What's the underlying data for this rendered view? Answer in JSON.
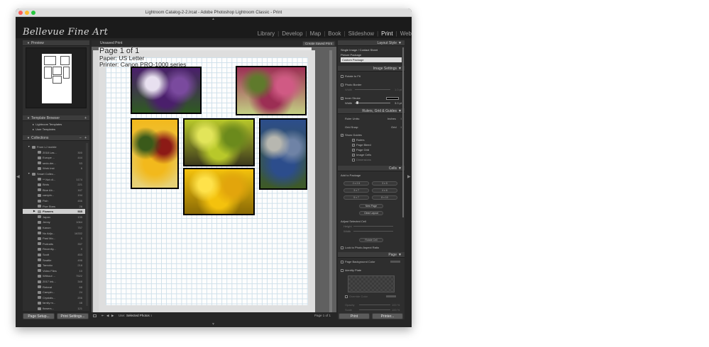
{
  "window": {
    "title": "Lightroom Catalog-2-2.lrcat - Adobe Photoshop Lightroom Classic - Print",
    "traffic_lights": {
      "close": "#fe5f57",
      "minimize": "#febc2e",
      "zoom": "#28c840"
    }
  },
  "app": {
    "brand": "Bellevue Fine Art",
    "modules": [
      "Library",
      "Develop",
      "Map",
      "Book",
      "Slideshow",
      "Print",
      "Web"
    ],
    "active_module": "Print"
  },
  "left_panel": {
    "preview": {
      "label": "Preview"
    },
    "template_browser": {
      "label": "Template Browser",
      "add": "+",
      "items": [
        "Lightroom Templates",
        "User Templates"
      ]
    },
    "collections": {
      "label": "Collections",
      "actions": [
        "−",
        "+"
      ]
    },
    "collection_rows": [
      {
        "name": "From LJ mobile",
        "count": "",
        "indent": 1,
        "tri": "▼"
      },
      {
        "name": "2018 Las...",
        "count": "300",
        "indent": 2
      },
      {
        "name": "Europe ...",
        "count": "444",
        "indent": 2
      },
      {
        "name": "sedo.dm...",
        "count": "53",
        "indent": 2
      },
      {
        "name": "Work inst",
        "count": "6",
        "indent": 2
      },
      {
        "name": "Smart Collec...",
        "count": "",
        "indent": 1,
        "tri": "▼"
      },
      {
        "name": "** Not di...",
        "count": "1174",
        "indent": 2
      },
      {
        "name": "Birds",
        "count": "221",
        "indent": 2
      },
      {
        "name": "Blue Ab...",
        "count": "167",
        "indent": 2
      },
      {
        "name": "campin...",
        "count": "194",
        "indent": 2
      },
      {
        "name": "Fish",
        "count": "456",
        "indent": 2
      },
      {
        "name": "Five Stars",
        "count": "28",
        "indent": 2
      },
      {
        "name": "Flowers",
        "count": "535",
        "indent": 2,
        "selected": true,
        "tri": "▶"
      },
      {
        "name": "Japan",
        "count": "135",
        "indent": 2
      },
      {
        "name": "Jenny",
        "count": "1064",
        "indent": 2
      },
      {
        "name": "Kanon",
        "count": "757",
        "indent": 2
      },
      {
        "name": "No Adju...",
        "count": "16332",
        "indent": 2
      },
      {
        "name": "Past Mo...",
        "count": "0",
        "indent": 2
      },
      {
        "name": "Portraits",
        "count": "337",
        "indent": 2
      },
      {
        "name": "Recently...",
        "count": "0",
        "indent": 2
      },
      {
        "name": "Scott",
        "count": "453",
        "indent": 2
      },
      {
        "name": "Seattle",
        "count": "498",
        "indent": 2
      },
      {
        "name": "Tamoko",
        "count": "218",
        "indent": 2
      },
      {
        "name": "Video Files",
        "count": "10",
        "indent": 2
      },
      {
        "name": "Without ...",
        "count": "7522",
        "indent": 2
      },
      {
        "name": "2017 Ink...",
        "count": "348",
        "indent": 2
      },
      {
        "name": "Retreat",
        "count": "68",
        "indent": 2
      },
      {
        "name": "Campin...",
        "count": "24",
        "indent": 2
      },
      {
        "name": "Crystals...",
        "count": "206",
        "indent": 2
      },
      {
        "name": "family m...",
        "count": "48",
        "indent": 2
      },
      {
        "name": "flowers...",
        "count": "121",
        "indent": 2
      }
    ],
    "page_setup": "Page Setup...",
    "print_settings": "Print Settings..."
  },
  "center": {
    "toolbar_title": "Unsaved Print",
    "create_saved": "Create Saved Print",
    "overlay": {
      "page": "Page 1 of 1",
      "paper": "Paper:  US Letter",
      "printer": "Printer:  Canon PRO-1000 series"
    },
    "photos": [
      {
        "name": "purple-tulips-photo",
        "colors": [
          "#4a1f6b",
          "#7a4a9e",
          "#e8e0f0",
          "#2f5a22"
        ]
      },
      {
        "name": "pink-blossom-photo",
        "colors": [
          "#9c2e54",
          "#d05a84",
          "#5f7a2c",
          "#c3cf83"
        ]
      },
      {
        "name": "red-yellow-tulips-photo",
        "colors": [
          "#f2b91c",
          "#8c1a16",
          "#3a5a1a",
          "#e6d27a"
        ]
      },
      {
        "name": "yellow-euphorbia-photo",
        "colors": [
          "#b8c82a",
          "#6b8a1c",
          "#e2e55a",
          "#3d3a1c"
        ]
      },
      {
        "name": "stacked-stones-photo",
        "colors": [
          "#2c4d8c",
          "#6f83a6",
          "#b7b7b0",
          "#3e5a25"
        ]
      },
      {
        "name": "yellow-flowers-photo",
        "colors": [
          "#f4c20d",
          "#e2a50c",
          "#ffe24a",
          "#8a6a05"
        ]
      }
    ],
    "bottom": {
      "use_label": "Use:",
      "use_value": "Selected Photos ↕",
      "page_count": "Page 1 of 1"
    }
  },
  "right_panel": {
    "layout_style": {
      "label": "Layout Style",
      "options": [
        "Single Image / Contact Sheet",
        "Picture Package",
        "Custom Package"
      ],
      "selected": "Custom Package"
    },
    "image_settings": {
      "label": "Image Settings",
      "rotate": "Rotate to Fit",
      "photo_border": "Photo Border",
      "width_label": "Width",
      "width_value": "1.0 pt",
      "inner_stroke": "Inner Stroke",
      "stroke_width_value": "3.0 pt"
    },
    "rulers": {
      "label": "Rulers, Grid & Guides",
      "ruler_units_label": "Ruler Units:",
      "ruler_units_value": "Inches",
      "grid_snap_label": "Grid Snap:",
      "grid_snap_value": "Grid",
      "show_guides": "Show Guides",
      "guides": [
        "Rulers",
        "Page Bleed",
        "Page Grid",
        "Image Cells",
        "Dimensions"
      ]
    },
    "cells": {
      "label": "Cells",
      "add_to_package": "Add to Package",
      "sizes": [
        "2 x 2.5",
        "3 x 5",
        "3 x 7",
        "4 x 6",
        "5 x 7",
        "8 x 10"
      ],
      "new_page": "New Page",
      "clear_layout": "Clear Layout",
      "adjust": "Adjust Selected Cell",
      "height": "Height",
      "width": "Width",
      "rotate_cell": "Rotate Cell",
      "lock_aspect": "Lock to Photo Aspect Ratio"
    },
    "page": {
      "label": "Page",
      "bg_color": "Page Background Color",
      "identity_plate": "Identity Plate",
      "override": "Override Color",
      "opacity": "Opacity",
      "opacity_value": "100 %",
      "scale": "Scale",
      "scale_value": "100 %"
    },
    "print": "Print",
    "printer": "Printer..."
  },
  "colors": {
    "app_bg": "#262626",
    "panel": "#2e2e2e",
    "selection": "#cfcfcf"
  }
}
